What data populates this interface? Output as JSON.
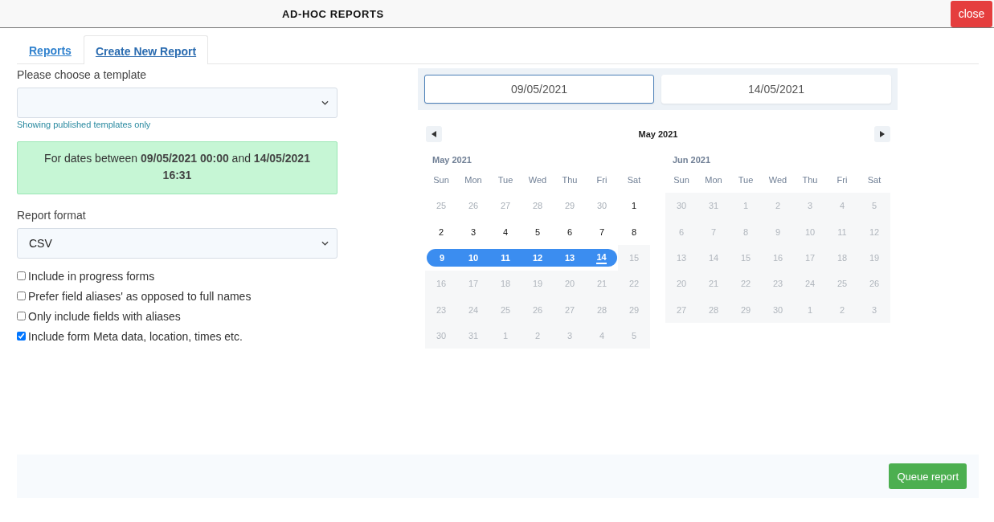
{
  "window": {
    "title": "AD-HOC REPORTS",
    "close_button": "close"
  },
  "tabs": [
    {
      "label": "Reports",
      "selected": false
    },
    {
      "label": "Create New Report",
      "selected": true
    }
  ],
  "template": {
    "label": "Please choose a template",
    "hint": "Showing published templates only"
  },
  "date_summary": "For dates between **09/05/2021 00:00** and **14/05/2021 16:31**",
  "format": {
    "label": "Report format",
    "value": "CSV"
  },
  "options": [
    {
      "label": "Include in progress forms",
      "checked": false
    },
    {
      "label": "Prefer field aliases' as opposed to full names",
      "checked": false
    },
    {
      "label": "Only include fields with aliases",
      "checked": false
    },
    {
      "label": "Include form Meta data, location, times etc.",
      "checked": true
    }
  ],
  "date_inputs": [
    {
      "value": "09/05/2021",
      "selected": true
    },
    {
      "value": "14/05/2021",
      "selected": false
    }
  ],
  "calendar": {
    "title": "May 2021",
    "months": [
      {
        "title": "May 2021",
        "weekdays": [
          "Sun",
          "Mon",
          "Tue",
          "Wed",
          "Thu",
          "Fri",
          "Sat"
        ],
        "weeks": [
          [
            {
              "label": "25",
              "kind": "outside"
            },
            {
              "label": "26",
              "kind": "outside"
            },
            {
              "label": "27",
              "kind": "outside"
            },
            {
              "label": "28",
              "kind": "outside"
            },
            {
              "label": "29",
              "kind": "outside"
            },
            {
              "label": "30",
              "kind": "outside"
            },
            {
              "label": "1",
              "kind": "available"
            }
          ],
          [
            {
              "label": "2",
              "kind": "available"
            },
            {
              "label": "3",
              "kind": "available"
            },
            {
              "label": "4",
              "kind": "available"
            },
            {
              "label": "5",
              "kind": "available"
            },
            {
              "label": "6",
              "kind": "available"
            },
            {
              "label": "7",
              "kind": "available"
            },
            {
              "label": "8",
              "kind": "available"
            }
          ],
          [
            {
              "label": "9",
              "kind": "selected"
            },
            {
              "label": "10",
              "kind": "selected"
            },
            {
              "label": "11",
              "kind": "selected"
            },
            {
              "label": "12",
              "kind": "selected"
            },
            {
              "label": "13",
              "kind": "selected"
            },
            {
              "label": "14",
              "kind": "selected_today"
            },
            {
              "label": "15",
              "kind": "disabled"
            }
          ],
          [
            {
              "label": "16",
              "kind": "disabled"
            },
            {
              "label": "17",
              "kind": "disabled"
            },
            {
              "label": "18",
              "kind": "disabled"
            },
            {
              "label": "19",
              "kind": "disabled"
            },
            {
              "label": "20",
              "kind": "disabled"
            },
            {
              "label": "21",
              "kind": "disabled"
            },
            {
              "label": "22",
              "kind": "disabled"
            }
          ],
          [
            {
              "label": "23",
              "kind": "disabled"
            },
            {
              "label": "24",
              "kind": "disabled"
            },
            {
              "label": "25",
              "kind": "disabled"
            },
            {
              "label": "26",
              "kind": "disabled"
            },
            {
              "label": "27",
              "kind": "disabled"
            },
            {
              "label": "28",
              "kind": "disabled"
            },
            {
              "label": "29",
              "kind": "disabled"
            }
          ],
          [
            {
              "label": "30",
              "kind": "disabled"
            },
            {
              "label": "31",
              "kind": "disabled"
            },
            {
              "label": "1",
              "kind": "disabled"
            },
            {
              "label": "2",
              "kind": "disabled"
            },
            {
              "label": "3",
              "kind": "disabled"
            },
            {
              "label": "4",
              "kind": "disabled"
            },
            {
              "label": "5",
              "kind": "disabled"
            }
          ]
        ]
      },
      {
        "title": "Jun 2021",
        "weekdays": [
          "Sun",
          "Mon",
          "Tue",
          "Wed",
          "Thu",
          "Fri",
          "Sat"
        ],
        "weeks": [
          [
            {
              "label": "30",
              "kind": "disabled"
            },
            {
              "label": "31",
              "kind": "disabled"
            },
            {
              "label": "1",
              "kind": "disabled"
            },
            {
              "label": "2",
              "kind": "disabled"
            },
            {
              "label": "3",
              "kind": "disabled"
            },
            {
              "label": "4",
              "kind": "disabled"
            },
            {
              "label": "5",
              "kind": "disabled"
            }
          ],
          [
            {
              "label": "6",
              "kind": "disabled"
            },
            {
              "label": "7",
              "kind": "disabled"
            },
            {
              "label": "8",
              "kind": "disabled"
            },
            {
              "label": "9",
              "kind": "disabled"
            },
            {
              "label": "10",
              "kind": "disabled"
            },
            {
              "label": "11",
              "kind": "disabled"
            },
            {
              "label": "12",
              "kind": "disabled"
            }
          ],
          [
            {
              "label": "13",
              "kind": "disabled"
            },
            {
              "label": "14",
              "kind": "disabled"
            },
            {
              "label": "15",
              "kind": "disabled"
            },
            {
              "label": "16",
              "kind": "disabled"
            },
            {
              "label": "17",
              "kind": "disabled"
            },
            {
              "label": "18",
              "kind": "disabled"
            },
            {
              "label": "19",
              "kind": "disabled"
            }
          ],
          [
            {
              "label": "20",
              "kind": "disabled"
            },
            {
              "label": "21",
              "kind": "disabled"
            },
            {
              "label": "22",
              "kind": "disabled"
            },
            {
              "label": "23",
              "kind": "disabled"
            },
            {
              "label": "24",
              "kind": "disabled"
            },
            {
              "label": "25",
              "kind": "disabled"
            },
            {
              "label": "26",
              "kind": "disabled"
            }
          ],
          [
            {
              "label": "27",
              "kind": "disabled"
            },
            {
              "label": "28",
              "kind": "disabled"
            },
            {
              "label": "29",
              "kind": "disabled"
            },
            {
              "label": "30",
              "kind": "disabled"
            },
            {
              "label": "1",
              "kind": "disabled"
            },
            {
              "label": "2",
              "kind": "disabled"
            },
            {
              "label": "3",
              "kind": "disabled"
            }
          ]
        ]
      }
    ]
  },
  "footer": {
    "button": "Queue report"
  }
}
